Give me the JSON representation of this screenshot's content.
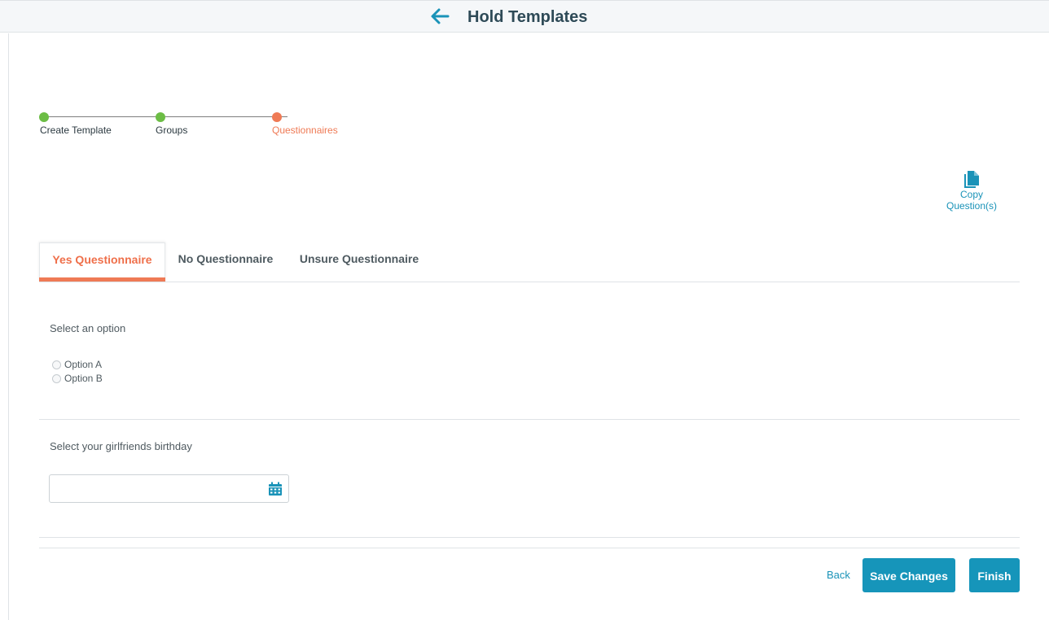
{
  "header": {
    "title": "Hold Templates",
    "back_icon": "arrow-left-icon"
  },
  "stepper": {
    "steps": [
      {
        "label": "Create Template",
        "status": "complete",
        "color": "#6cbd45"
      },
      {
        "label": "Groups",
        "status": "complete",
        "color": "#6cbd45"
      },
      {
        "label": "Questionnaires",
        "status": "current",
        "color": "#ef7a55"
      }
    ]
  },
  "toolbar": {
    "copy_label_line1": "Copy",
    "copy_label_line2": "Question(s)",
    "copy_icon": "copy-document-icon"
  },
  "tabs": [
    {
      "label": "Yes Questionnaire",
      "active": true
    },
    {
      "label": "No Questionnaire",
      "active": false
    },
    {
      "label": "Unsure Questionnaire",
      "active": false
    }
  ],
  "questions": [
    {
      "type": "radio",
      "label": "Select an option",
      "options": [
        "Option A",
        "Option B"
      ],
      "selected": null
    },
    {
      "type": "date",
      "label": "Select your girlfriends birthday",
      "value": "",
      "icon": "calendar-icon"
    }
  ],
  "footer": {
    "back_label": "Back",
    "save_label": "Save Changes",
    "finish_label": "Finish"
  },
  "colors": {
    "accent": "#1695ba",
    "active_tab": "#ef6f4a",
    "complete_step": "#6cbd45",
    "current_step": "#ef7a55"
  }
}
